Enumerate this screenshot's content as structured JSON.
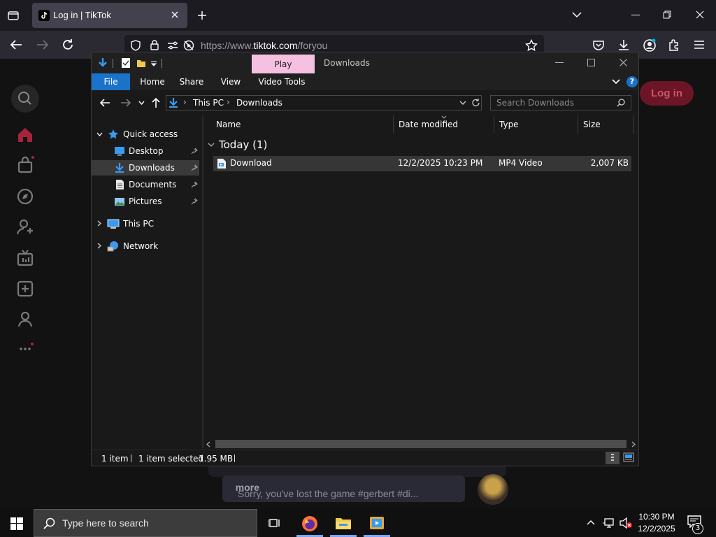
{
  "browser": {
    "tab_title": "Log in | TikTok",
    "url_prefix": "https://www.",
    "url_domain": "tiktok.com",
    "url_path": "/foryou"
  },
  "tiktok": {
    "login_label": "Log in",
    "caption": "Sorry, you've lost the game #gerbert #di...",
    "more_label": "more",
    "accent": "#fe2c55"
  },
  "explorer": {
    "title": "Downloads",
    "contextual_tab": "Play",
    "ribbon_tabs": [
      "File",
      "Home",
      "Share",
      "View",
      "Video Tools"
    ],
    "breadcrumb": [
      "This PC",
      "Downloads"
    ],
    "search_placeholder": "Search Downloads",
    "nav": {
      "quick_access": "Quick access",
      "desktop": "Desktop",
      "downloads": "Downloads",
      "documents": "Documents",
      "pictures": "Pictures",
      "this_pc": "This PC",
      "network": "Network"
    },
    "columns": [
      "Name",
      "Date modified",
      "Type",
      "Size"
    ],
    "group_header": "Today (1)",
    "files": [
      {
        "name": "Download",
        "date": "12/2/2025 10:23 PM",
        "type": "MP4 Video",
        "size": "2,007 KB"
      }
    ],
    "status": {
      "count": "1 item",
      "selected": "1 item selected",
      "size": "1.95 MB"
    }
  },
  "taskbar": {
    "search_placeholder": "Type here to search",
    "time": "10:30 PM",
    "date": "12/2/2025",
    "notification_count": "3"
  }
}
